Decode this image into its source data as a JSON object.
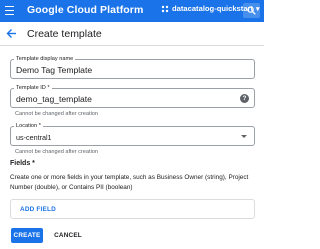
{
  "topbar": {
    "brand": "Google Cloud Platform",
    "project": "datacatalog-quickstart",
    "icons": [
      "menu-icon",
      "project-icon",
      "chevron-down-icon",
      "search-icon"
    ]
  },
  "header": {
    "title": "Create template",
    "back_icon": "arrow-back-icon"
  },
  "form": {
    "display_name": {
      "label": "Template display name",
      "value": "Demo Tag Template"
    },
    "template_id": {
      "label": "Template ID *",
      "value": "demo_tag_template",
      "hint": "Cannot be changed after creation",
      "help": "?"
    },
    "location": {
      "label": "Location *",
      "value": "us-central1",
      "hint": "Cannot be changed after creation"
    },
    "fields": {
      "title": "Fields *",
      "description": "Create one or more fields in your template, such as Business Owner (string), Project Number (double), or Contains PII (boolean)",
      "add_label": "ADD FIELD"
    }
  },
  "actions": {
    "create": "CREATE",
    "cancel": "CANCEL"
  },
  "colors": {
    "primary": "#1a73e8",
    "text": "#202124",
    "muted": "#5f6368",
    "border": "#dadce0"
  }
}
